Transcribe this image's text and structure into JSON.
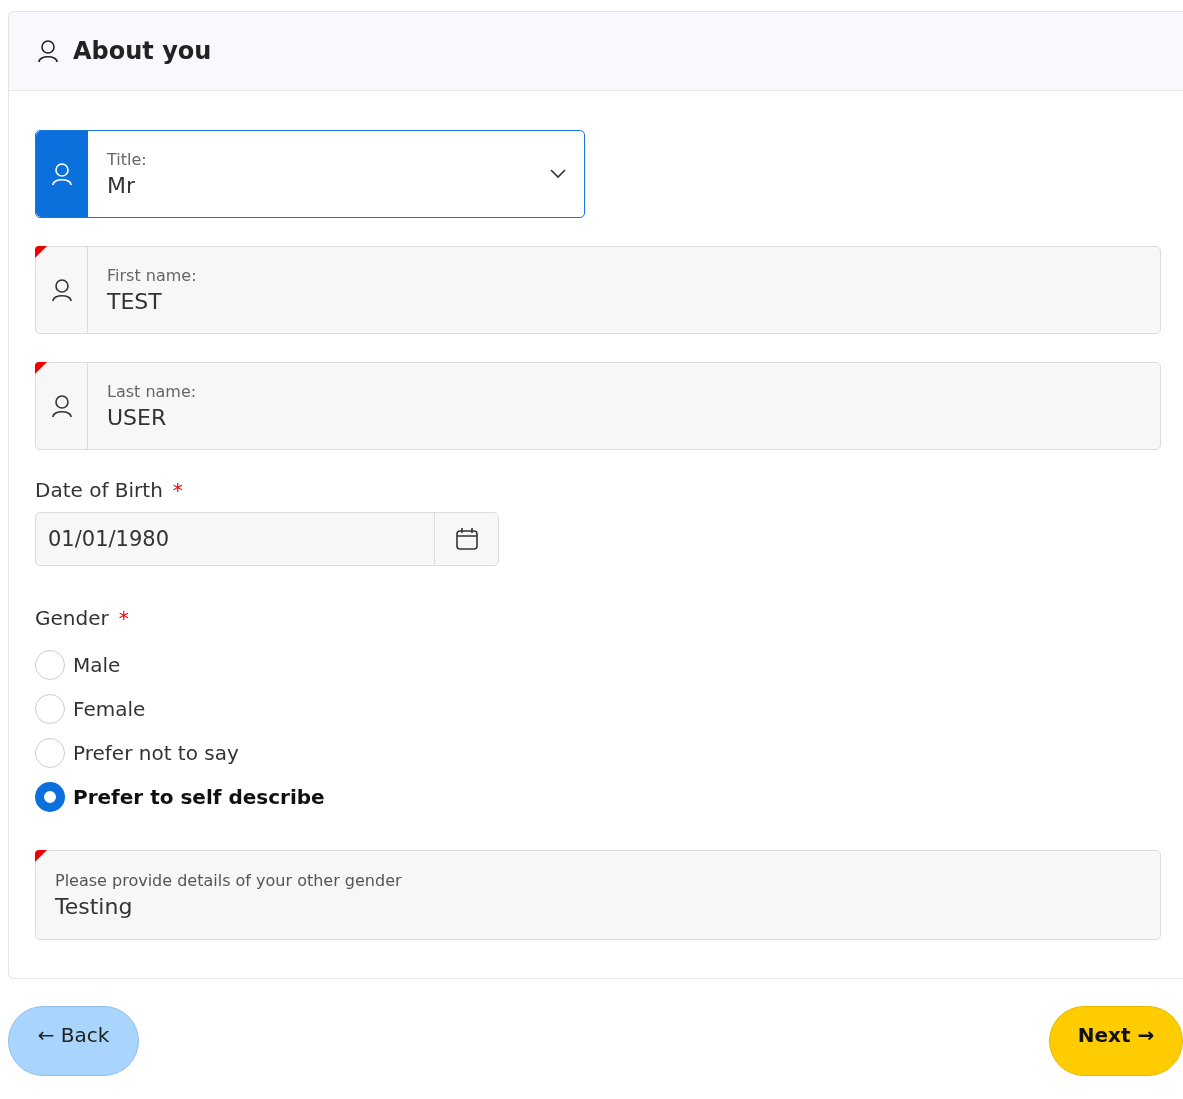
{
  "section": {
    "title": "About you"
  },
  "fields": [
    {
      "kind": "select",
      "label": "Title:",
      "value": "Mr",
      "focused": true,
      "required": false
    },
    {
      "kind": "text",
      "label": "First name:",
      "value": "TEST",
      "focused": false,
      "required": true
    },
    {
      "kind": "text",
      "label": "Last name:",
      "value": "USER",
      "focused": false,
      "required": true
    }
  ],
  "date_of_birth": {
    "label": "Date of Birth",
    "required_mark": "*",
    "value": "01/01/1980"
  },
  "gender": {
    "label": "Gender",
    "required_mark": "*",
    "options": [
      {
        "label": "Male",
        "selected": false
      },
      {
        "label": "Female",
        "selected": false
      },
      {
        "label": "Prefer not to say",
        "selected": false
      },
      {
        "label": "Prefer to self describe",
        "selected": true
      }
    ]
  },
  "other_gender": {
    "label": "Please provide details of your other gender",
    "value": "Testing",
    "required": true
  },
  "buttons": [
    {
      "kind": "back",
      "label": "Back",
      "arrow": "←"
    },
    {
      "kind": "next",
      "label": "Next",
      "arrow": "→"
    }
  ]
}
